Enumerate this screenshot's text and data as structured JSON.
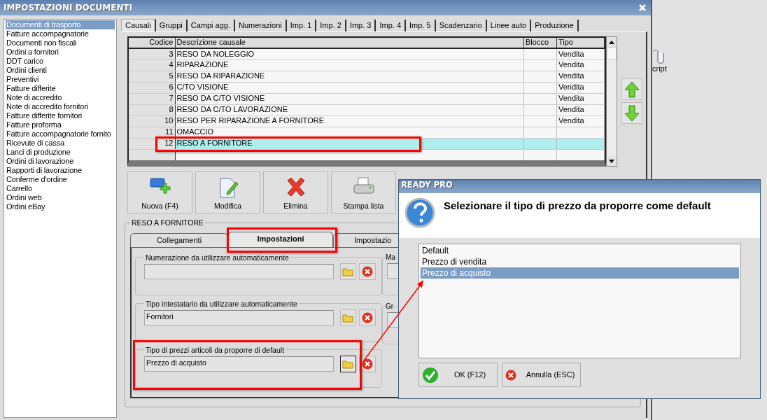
{
  "window": {
    "title": "IMPOSTAZIONI DOCUMENTI"
  },
  "sidebar": {
    "items": [
      {
        "label": "Documenti di trasporto",
        "selected": true
      },
      {
        "label": "Fatture accompagnatorie",
        "selected": false
      },
      {
        "label": "Documenti non fiscali",
        "selected": false
      },
      {
        "label": "Ordini a fornitori",
        "selected": false
      },
      {
        "label": "DDT carico",
        "selected": false
      },
      {
        "label": "Ordini clienti",
        "selected": false
      },
      {
        "label": "Preventivi",
        "selected": false
      },
      {
        "label": "Fatture differite",
        "selected": false
      },
      {
        "label": "Note di accredito",
        "selected": false
      },
      {
        "label": "Note di accredito fornitori",
        "selected": false
      },
      {
        "label": "Fatture differite fornitori",
        "selected": false
      },
      {
        "label": "Fatture proforma",
        "selected": false
      },
      {
        "label": "Fatture accompagnatorie fornito",
        "selected": false
      },
      {
        "label": "Ricevute di cassa",
        "selected": false
      },
      {
        "label": "Lanci di produzione",
        "selected": false
      },
      {
        "label": "Ordini di lavorazione",
        "selected": false
      },
      {
        "label": "Rapporti di lavorazione",
        "selected": false
      },
      {
        "label": "Conferme d'ordine",
        "selected": false
      },
      {
        "label": "Carrello",
        "selected": false
      },
      {
        "label": "Ordini web",
        "selected": false
      },
      {
        "label": "Ordini eBay",
        "selected": false
      }
    ]
  },
  "tabs": [
    {
      "label": "Causali",
      "selected": true
    },
    {
      "label": "Gruppi",
      "selected": false
    },
    {
      "label": "Campi agg.",
      "selected": false
    },
    {
      "label": "Numerazioni",
      "selected": false
    },
    {
      "label": "Imp. 1",
      "selected": false
    },
    {
      "label": "Imp. 2",
      "selected": false
    },
    {
      "label": "Imp. 3",
      "selected": false
    },
    {
      "label": "Imp. 4",
      "selected": false
    },
    {
      "label": "Imp. 5",
      "selected": false
    },
    {
      "label": "Scadenzario",
      "selected": false
    },
    {
      "label": "Linee auto",
      "selected": false
    },
    {
      "label": "Produzione",
      "selected": false
    }
  ],
  "table": {
    "columns": [
      "Codice",
      "Descrizione causale",
      "Blocco",
      "Tipo"
    ],
    "rows": [
      {
        "codice": "3",
        "descrizione": "RESO DA NOLEGGIO",
        "tipo": "Vendita",
        "selected": false
      },
      {
        "codice": "4",
        "descrizione": "RIPARAZIONE",
        "tipo": "Vendita",
        "selected": false
      },
      {
        "codice": "5",
        "descrizione": "RESO DA RIPARAZIONE",
        "tipo": "Vendita",
        "selected": false
      },
      {
        "codice": "6",
        "descrizione": "C/TO VISIONE",
        "tipo": "Vendita",
        "selected": false
      },
      {
        "codice": "7",
        "descrizione": "RESO DA C/TO VISIONE",
        "tipo": "Vendita",
        "selected": false
      },
      {
        "codice": "8",
        "descrizione": "RESO DA C/TO LAVORAZIONE",
        "tipo": "Vendita",
        "selected": false
      },
      {
        "codice": "10",
        "descrizione": "RESO PER RIPARAZIONE A FORNITORE",
        "tipo": "Vendita",
        "selected": false
      },
      {
        "codice": "11",
        "descrizione": "OMACCIO",
        "selected": false
      },
      {
        "codice": "12",
        "descrizione": "RESO A FORNITORE",
        "selected": true
      }
    ]
  },
  "toolbar": [
    {
      "label": "Nuova (F4)",
      "kind": "new"
    },
    {
      "label": "Modifica",
      "kind": "edit"
    },
    {
      "label": "Elimina",
      "kind": "delete"
    },
    {
      "label": "Stampa lista",
      "kind": "print"
    }
  ],
  "detail": {
    "title": "RESO A FORNITORE",
    "tabs": [
      {
        "label": "Collegamenti",
        "selected": false
      },
      {
        "label": "Impostazioni",
        "selected": true
      },
      {
        "label": "Impostazio",
        "selected": false
      }
    ],
    "groups": [
      {
        "label": "Numerazione da utilizzare automaticamente"
      },
      {
        "label": "Tipo intestatario da utilizzare automaticamente",
        "value": "Fornitori"
      },
      {
        "label": "Tipo di prezzi articoli da proporre di default",
        "value": "Prezzo di acquisto"
      }
    ],
    "side_groups": [
      {
        "label": "Ma"
      },
      {
        "label": "Gr"
      }
    ]
  },
  "desktop_icon": {
    "label": "cript"
  },
  "dialog": {
    "title": "READY PRO",
    "message": "Selezionare il tipo di prezzo da proporre come default",
    "options": [
      {
        "label": "Default",
        "selected": false
      },
      {
        "label": "Prezzo di vendita",
        "selected": false
      },
      {
        "label": "Prezzo di acquisto",
        "selected": true
      }
    ],
    "buttons": [
      {
        "label": "OK (F12)",
        "kind": "ok"
      },
      {
        "label": "Annulla (ESC)",
        "kind": "cancel"
      }
    ]
  }
}
